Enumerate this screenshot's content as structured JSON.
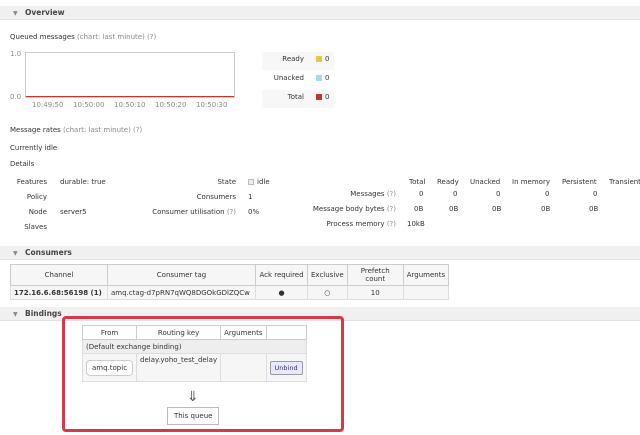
{
  "overview": {
    "title": "Overview",
    "queued_label": "Queued messages",
    "queued_suffix": "(chart: last minute) (?)",
    "y_top": "1.0",
    "y_bottom": "0.0",
    "x_ticks": [
      "10:49:50",
      "10:50:00",
      "10:50:10",
      "10:50:20",
      "10:50:30"
    ],
    "legend": [
      {
        "label": "Ready",
        "value": "0",
        "color": "#e8c842"
      },
      {
        "label": "Unacked",
        "value": "0",
        "color": "#a8d8ea"
      },
      {
        "label": "Total",
        "value": "0",
        "color": "#c0392b"
      }
    ],
    "rates_label": "Message rates",
    "rates_suffix": "(chart: last minute) (?)",
    "idle_text": "Currently idle",
    "details_label": "Details"
  },
  "details": {
    "features_label": "Features",
    "features_value": "durable: true",
    "policy_label": "Policy",
    "node_label": "Node",
    "node_value": "server5",
    "slaves_label": "Slaves",
    "state_label": "State",
    "state_value": "idle",
    "consumers_label": "Consumers",
    "consumers_value": "1",
    "util_label": "Consumer utilisation",
    "util_help": "(?)",
    "util_value": "0%",
    "stat_headers": [
      "Total",
      "Ready",
      "Unacked",
      "In memory",
      "Persistent",
      "Transient"
    ],
    "messages_label": "Messages",
    "messages_help": "(?)",
    "messages_values": [
      "0",
      "0",
      "0",
      "0",
      "0"
    ],
    "body_label": "Message body bytes",
    "body_help": "(?)",
    "body_values": [
      "0B",
      "0B",
      "0B",
      "0B",
      "0B"
    ],
    "procmem_label": "Process memory",
    "procmem_help": "(?)",
    "procmem_value": "10kB"
  },
  "consumers": {
    "title": "Consumers",
    "headers": [
      "Channel",
      "Consumer tag",
      "Ack required",
      "Exclusive",
      "Prefetch count",
      "Arguments"
    ],
    "row": {
      "channel": "172.16.6.68:56198 (1)",
      "tag": "amq.ctag-d7pRN7qWQ8DGOkGDlZQCw",
      "ack": "●",
      "exclusive": "○",
      "prefetch": "10",
      "arguments": ""
    }
  },
  "bindings": {
    "title": "Bindings",
    "headers": [
      "From",
      "Routing key",
      "Arguments"
    ],
    "default_binding": "(Default exchange binding)",
    "from": "amq.topic",
    "routing_key": "delay.yoho_test_delay",
    "unbind": "Unbind",
    "arrow": "⇓",
    "this_queue": "This queue"
  }
}
